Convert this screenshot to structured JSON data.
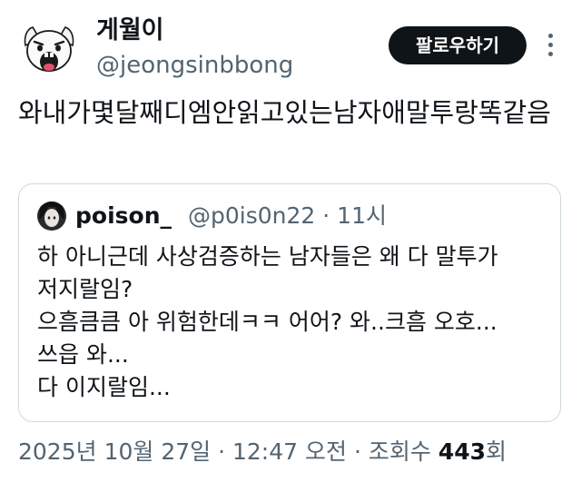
{
  "author": {
    "display_name": "게월이",
    "handle": "@jeongsinbbong",
    "avatar_icon": "cartoon-face-avatar-icon"
  },
  "actions": {
    "follow_label": "팔로우하기",
    "more_icon": "more-vertical-icon"
  },
  "tweet": {
    "text": "와내가몇달째디엠안읽고있는남자애말투랑똑같음"
  },
  "quote": {
    "name": "poison_",
    "handle": "@p0is0n22",
    "separator": "·",
    "time": "11시",
    "avatar_icon": "profile-photo-avatar-icon",
    "lines": [
      "하 아니근데 사상검증하는 남자들은 왜 다 말투가",
      "저지랄임?",
      "으흠큼큼 아 위험한데ㅋㅋ 어어? 와..크흠 오호...",
      "쓰읍 와...",
      "다 이지랄임..."
    ]
  },
  "meta": {
    "date": "2025년 10월 27일",
    "separator": "·",
    "time": "12:47 오전",
    "views_label": "조회수",
    "views_count": "443",
    "views_suffix": "회"
  },
  "colors": {
    "text_primary": "#0f1419",
    "text_secondary": "#536471",
    "border": "#cfd9de",
    "button_bg": "#0f1419"
  }
}
